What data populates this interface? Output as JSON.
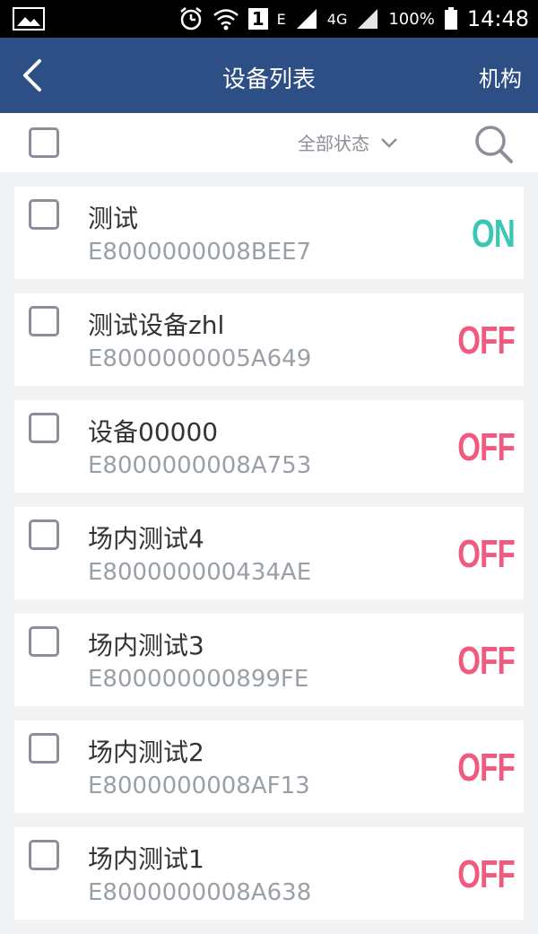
{
  "status_bar": {
    "battery": "100%",
    "time": "14:48",
    "network_e": "E",
    "network_4g": "4G",
    "sim_slot": "1"
  },
  "header": {
    "title": "设备列表",
    "org_label": "机构"
  },
  "filter": {
    "status_label": "全部状态"
  },
  "colors": {
    "header_bg": "#2e4f86",
    "on": "#3cc6b3",
    "off": "#f05a7e"
  },
  "devices": [
    {
      "name": "测试",
      "serial": "E8000000008BEE7",
      "state": "ON"
    },
    {
      "name": "测试设备zhl",
      "serial": "E8000000005A649",
      "state": "OFF"
    },
    {
      "name": "设备00000",
      "serial": "E8000000008A753",
      "state": "OFF"
    },
    {
      "name": "场内测试4",
      "serial": "E800000000434AE",
      "state": "OFF"
    },
    {
      "name": "场内测试3",
      "serial": "E800000000899FE",
      "state": "OFF"
    },
    {
      "name": "场内测试2",
      "serial": "E8000000008AF13",
      "state": "OFF"
    },
    {
      "name": "场内测试1",
      "serial": "E8000000008A638",
      "state": "OFF"
    }
  ]
}
